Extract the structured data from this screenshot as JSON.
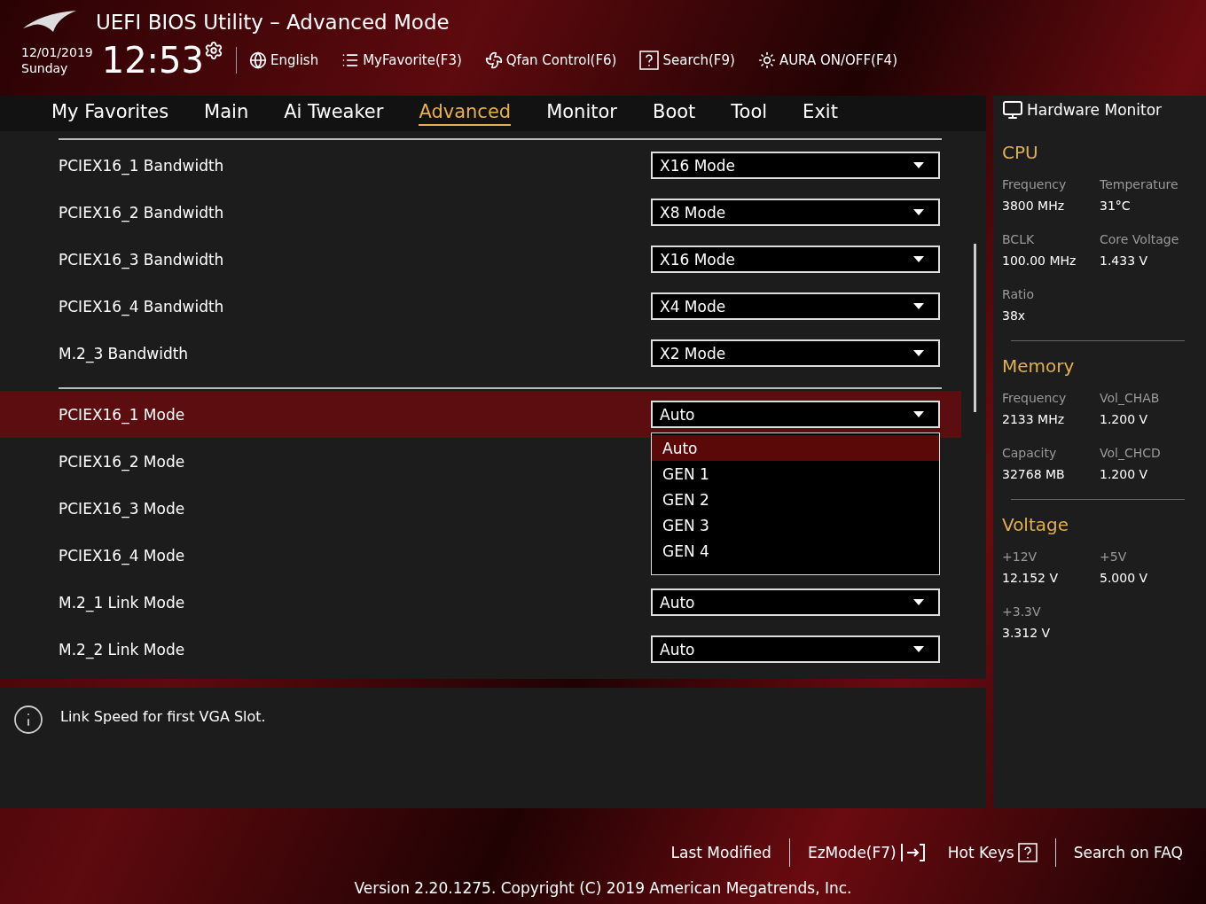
{
  "header": {
    "title": "UEFI BIOS Utility – Advanced Mode",
    "date": "12/01/2019",
    "day": "Sunday",
    "time": "12:53",
    "language": "English",
    "tools": [
      "MyFavorite(F3)",
      "Qfan Control(F6)",
      "Search(F9)",
      "AURA ON/OFF(F4)"
    ]
  },
  "tabs": [
    {
      "label": "My Favorites",
      "selected": false
    },
    {
      "label": "Main",
      "selected": false
    },
    {
      "label": "Ai Tweaker",
      "selected": false
    },
    {
      "label": "Advanced",
      "selected": true
    },
    {
      "label": "Monitor",
      "selected": false
    },
    {
      "label": "Boot",
      "selected": false
    },
    {
      "label": "Tool",
      "selected": false
    },
    {
      "label": "Exit",
      "selected": false
    }
  ],
  "settings": [
    {
      "items": [
        {
          "label": "PCIEX16_1 Bandwidth",
          "value": "X16 Mode",
          "highlighted": false
        },
        {
          "label": "PCIEX16_2 Bandwidth",
          "value": "X8 Mode",
          "highlighted": false
        },
        {
          "label": "PCIEX16_3 Bandwidth",
          "value": "X16 Mode",
          "highlighted": false
        },
        {
          "label": "PCIEX16_4 Bandwidth",
          "value": "X4 Mode",
          "highlighted": false
        },
        {
          "label": "M.2_3 Bandwidth",
          "value": "X2 Mode",
          "highlighted": false
        }
      ]
    },
    {
      "items": [
        {
          "label": "PCIEX16_1 Mode",
          "value": "Auto",
          "highlighted": true,
          "options": [
            {
              "label": "Auto",
              "selected": true
            },
            {
              "label": "GEN 1",
              "selected": false
            },
            {
              "label": "GEN 2",
              "selected": false
            },
            {
              "label": "GEN 3",
              "selected": false
            },
            {
              "label": "GEN 4",
              "selected": false
            }
          ]
        },
        {
          "label": "PCIEX16_2 Mode",
          "highlighted": false
        },
        {
          "label": "PCIEX16_3 Mode",
          "highlighted": false
        },
        {
          "label": "PCIEX16_4 Mode",
          "highlighted": false
        },
        {
          "label": "M.2_1 Link Mode",
          "value": "Auto",
          "highlighted": false
        },
        {
          "label": "M.2_2 Link Mode",
          "value": "Auto",
          "highlighted": false
        }
      ]
    }
  ],
  "help_text": "Link Speed for first VGA Slot.",
  "hardware_monitor": {
    "title": "Hardware Monitor",
    "sections": [
      {
        "title": "CPU",
        "fields": [
          {
            "label": "Frequency",
            "value": "3800 MHz"
          },
          {
            "label": "Temperature",
            "value": "31°C"
          },
          {
            "label": "BCLK",
            "value": "100.00 MHz"
          },
          {
            "label": "Core Voltage",
            "value": "1.433 V"
          },
          {
            "label": "Ratio",
            "value": "38x"
          }
        ]
      },
      {
        "title": "Memory",
        "fields": [
          {
            "label": "Frequency",
            "value": "2133 MHz"
          },
          {
            "label": "Vol_CHAB",
            "value": "1.200 V"
          },
          {
            "label": "Capacity",
            "value": "32768 MB"
          },
          {
            "label": "Vol_CHCD",
            "value": "1.200 V"
          }
        ]
      },
      {
        "title": "Voltage",
        "fields": [
          {
            "label": "+12V",
            "value": "12.152 V"
          },
          {
            "label": "+5V",
            "value": "5.000 V"
          },
          {
            "label": "+3.3V",
            "value": "3.312 V"
          }
        ]
      }
    ]
  },
  "footer": {
    "links": [
      "Last Modified",
      "EzMode(F7)",
      "Hot Keys",
      "Search on FAQ"
    ],
    "version": "Version 2.20.1275. Copyright (C) 2019 American Megatrends, Inc."
  }
}
